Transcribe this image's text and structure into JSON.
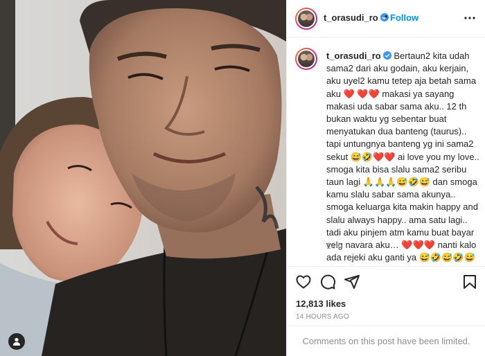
{
  "post": {
    "username": "t_orasudi_ro",
    "header_separator": "•",
    "follow_label": "Follow",
    "caption": "Bertaun2 kita udah sama2 dari aku godain, aku kerjain, aku uyel2 kamu tetep aja betah sama aku ❤️ ❤️❤️ makasi ya sayang makasi uda sabar sama aku.. 12 th bukan waktu yg sebentar buat menyatukan dua banteng (taurus).. tapi untungnya banteng yg ini sama2 sekut 😅🤣❤️❤️ ai love you my love.. smoga kita bisa slalu sama2 seribu taun lagi 🙏🙏🙏😅🤣😅 dan smoga kamu slalu sabar sama akunya.. smoga keluarga kita makin happy and slalu always happy.. ama satu lagi.. tadi aku pinjem atm kamu buat bayar velg navara aku… ❤️❤️❤️ nanti kalo ada rejeki aku ganti ya 😅🤣😅🤣😅😅 Happy anniversary istri ❤️",
    "time_relative": "14 h",
    "likes": "12,813 likes",
    "time_absolute": "14 HOURS AGO",
    "comments_notice": "Comments on this post have been limited."
  },
  "icons": {
    "user_tag": "person-icon",
    "verified": "verified-badge-icon",
    "more": "more-options-icon",
    "like": "heart-icon",
    "comment": "comment-icon",
    "share": "share-icon",
    "save": "bookmark-icon"
  },
  "colors": {
    "link_blue": "#0095f6",
    "verified_blue": "#3897f0",
    "muted_text": "#8e8e8e",
    "border": "#efefef"
  }
}
